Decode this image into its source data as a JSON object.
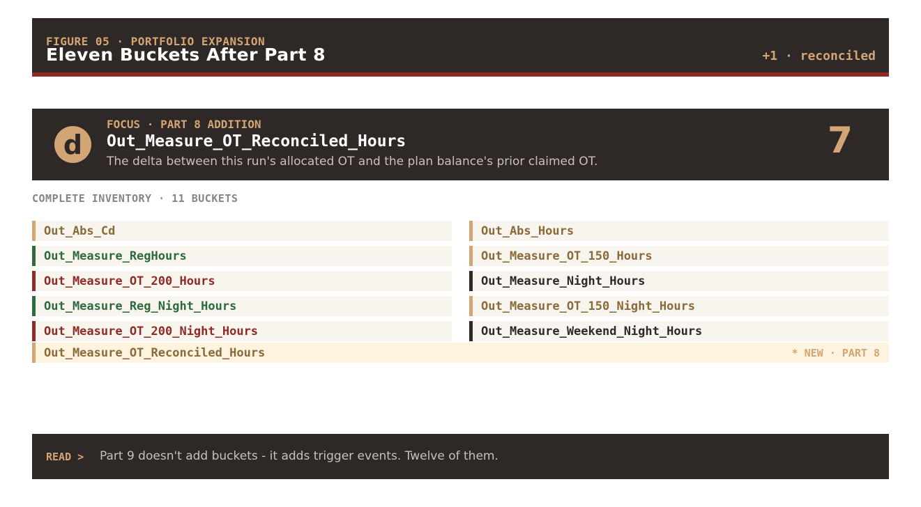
{
  "header": {
    "kicker": "FIGURE 05 · PORTFOLIO EXPANSION",
    "title": "Eleven Buckets After Part 8",
    "status": "+1 · reconciled",
    "accent_color": "#d4a574",
    "stripe_color": "#8e2b25"
  },
  "focus": {
    "badge": "d",
    "kicker": "FOCUS · PART 8 ADDITION",
    "name": "Out_Measure_OT_Reconciled_Hours",
    "description": "The delta between this run's allocated OT and the plan balance's prior claimed OT.",
    "number": "7"
  },
  "inventory": {
    "title": "COMPLETE INVENTORY · 11 BUCKETS",
    "items": [
      {
        "label": "Out_Abs_Cd",
        "color": "#d4a574"
      },
      {
        "label": "Out_Abs_Hours",
        "color": "#d4a574"
      },
      {
        "label": "Out_Measure_RegHours",
        "color": "#2d6a3e"
      },
      {
        "label": "Out_Measure_OT_150_Hours",
        "color": "#d4a574"
      },
      {
        "label": "Out_Measure_OT_200_Hours",
        "color": "#8e2b25"
      },
      {
        "label": "Out_Measure_Night_Hours",
        "color": "#2e2926"
      },
      {
        "label": "Out_Measure_Reg_Night_Hours",
        "color": "#2d6a3e"
      },
      {
        "label": "Out_Measure_OT_150_Night_Hours",
        "color": "#d4a574"
      },
      {
        "label": "Out_Measure_OT_200_Night_Hours",
        "color": "#8e2b25"
      },
      {
        "label": "Out_Measure_Weekend_Night_Hours",
        "color": "#2e2926"
      }
    ],
    "new_item": {
      "label": "Out_Measure_OT_Reconciled_Hours",
      "tag": "* NEW · PART 8",
      "color": "#d4a574"
    }
  },
  "footer": {
    "label": "READ >",
    "text": "Part 9 doesn't add buckets - it adds trigger events. Twelve of them."
  }
}
